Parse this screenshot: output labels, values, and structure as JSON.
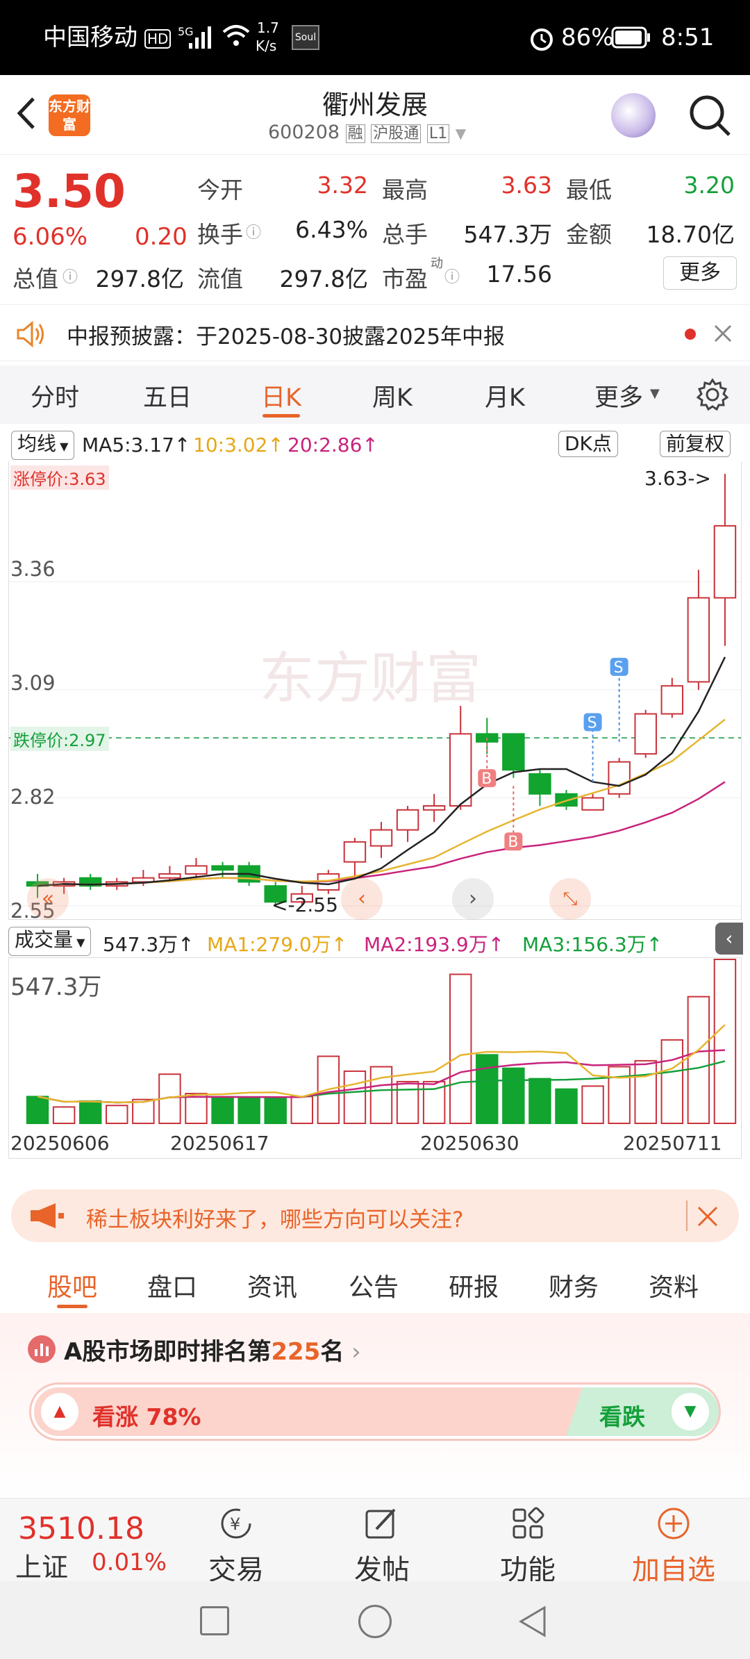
{
  "status": {
    "carrier": "中国移动",
    "hd": "HD",
    "net": "5G",
    "speed_num": "1.7",
    "speed_unit": "K/s",
    "app": "Soul",
    "battery": "86%",
    "time": "8:51"
  },
  "header": {
    "logo": "东方财富",
    "title": "衢州发展",
    "code": "600208",
    "badge1": "融",
    "badge2": "沪股通",
    "badge3": "L1"
  },
  "quote": {
    "price": "3.50",
    "pct": "6.06%",
    "change": "0.20",
    "open_label": "今开",
    "open": "3.32",
    "high_label": "最高",
    "high": "3.63",
    "low_label": "最低",
    "low": "3.20",
    "turnover_label": "换手",
    "turnover": "6.43%",
    "vol_label": "总手",
    "vol": "547.3万",
    "amount_label": "金额",
    "amount": "18.70亿",
    "mcap_label": "总值",
    "mcap": "297.8亿",
    "float_label": "流值",
    "float": "297.8亿",
    "pe_label": "市盈",
    "pe_sup": "动",
    "pe": "17.56",
    "more": "更多"
  },
  "notice": {
    "text": "中报预披露：于2025-08-30披露2025年中报"
  },
  "tabs": [
    "分时",
    "五日",
    "日K",
    "周K",
    "月K",
    "更多"
  ],
  "ma": {
    "selector": "均线",
    "ma5": "MA5:3.17↑",
    "ma10": "10:3.02↑",
    "ma20": "20:2.86↑",
    "dk": "DK点",
    "adjust": "前复权"
  },
  "kline": {
    "limit_up_label": "涨停价:3.63",
    "limit_down_label": "跌停价:2.97",
    "max_marker": "3.63->",
    "min_marker": "<-2.55",
    "watermark": "东方财富",
    "y_ticks": [
      "3.36",
      "3.09",
      "2.82",
      "2.55"
    ]
  },
  "volume": {
    "selector": "成交量",
    "value": "547.3万↑",
    "ma1": "MA1:279.0万↑",
    "ma2": "MA2:193.9万↑",
    "ma3": "MA3:156.3万↑",
    "max_label": "547.3万",
    "dates": [
      "20250606",
      "20250617",
      "20250630",
      "20250711"
    ]
  },
  "banner": {
    "text": "稀土板块利好来了，哪些方向可以关注?"
  },
  "subtabs": [
    "股吧",
    "盘口",
    "资讯",
    "公告",
    "研报",
    "财务",
    "资料"
  ],
  "rank": {
    "prefix": "A股市场即时排名第",
    "num": "225",
    "suffix": "名",
    "up_label": "看涨 78%",
    "down_label": "看跌"
  },
  "bottom": {
    "index_value": "3510.18",
    "index_name": "上证",
    "index_pct": "0.01%",
    "trade": "交易",
    "post": "发帖",
    "func": "功能",
    "add": "加自选"
  },
  "chart_data": {
    "type": "candlestick",
    "y_axis_ticks": [
      3.36,
      3.09,
      2.82,
      2.55
    ],
    "ylim": [
      2.55,
      3.63
    ],
    "limit_up": 3.63,
    "limit_down": 2.97,
    "dates_labeled": [
      "20250606",
      "20250617",
      "20250630",
      "20250711"
    ],
    "candles": [
      {
        "o": 2.61,
        "c": 2.6,
        "h": 2.63,
        "l": 2.57
      },
      {
        "o": 2.6,
        "c": 2.61,
        "h": 2.62,
        "l": 2.58
      },
      {
        "o": 2.62,
        "c": 2.6,
        "h": 2.63,
        "l": 2.59
      },
      {
        "o": 2.6,
        "c": 2.61,
        "h": 2.62,
        "l": 2.59
      },
      {
        "o": 2.61,
        "c": 2.62,
        "h": 2.64,
        "l": 2.6
      },
      {
        "o": 2.62,
        "c": 2.63,
        "h": 2.65,
        "l": 2.61
      },
      {
        "o": 2.63,
        "c": 2.65,
        "h": 2.67,
        "l": 2.62
      },
      {
        "o": 2.65,
        "c": 2.64,
        "h": 2.66,
        "l": 2.62
      },
      {
        "o": 2.65,
        "c": 2.61,
        "h": 2.66,
        "l": 2.6
      },
      {
        "o": 2.6,
        "c": 2.56,
        "h": 2.61,
        "l": 2.55
      },
      {
        "o": 2.56,
        "c": 2.58,
        "h": 2.6,
        "l": 2.55
      },
      {
        "o": 2.59,
        "c": 2.63,
        "h": 2.64,
        "l": 2.58
      },
      {
        "o": 2.66,
        "c": 2.71,
        "h": 2.72,
        "l": 2.62
      },
      {
        "o": 2.7,
        "c": 2.74,
        "h": 2.76,
        "l": 2.67
      },
      {
        "o": 2.74,
        "c": 2.79,
        "h": 2.8,
        "l": 2.71
      },
      {
        "o": 2.79,
        "c": 2.8,
        "h": 2.83,
        "l": 2.76
      },
      {
        "o": 2.8,
        "c": 2.98,
        "h": 3.05,
        "l": 2.79
      },
      {
        "o": 2.98,
        "c": 2.96,
        "h": 3.02,
        "l": 2.93
      },
      {
        "o": 2.98,
        "c": 2.89,
        "h": 2.98,
        "l": 2.87
      },
      {
        "o": 2.88,
        "c": 2.83,
        "h": 2.89,
        "l": 2.8
      },
      {
        "o": 2.83,
        "c": 2.8,
        "h": 2.84,
        "l": 2.79
      },
      {
        "o": 2.79,
        "c": 2.82,
        "h": 2.83,
        "l": 2.79
      },
      {
        "o": 2.83,
        "c": 2.91,
        "h": 2.92,
        "l": 2.82
      },
      {
        "o": 2.93,
        "c": 3.03,
        "h": 3.04,
        "l": 2.92
      },
      {
        "o": 3.03,
        "c": 3.1,
        "h": 3.12,
        "l": 3.02
      },
      {
        "o": 3.11,
        "c": 3.32,
        "h": 3.39,
        "l": 3.09
      },
      {
        "o": 3.32,
        "c": 3.5,
        "h": 3.63,
        "l": 3.2
      }
    ],
    "volumes": [
      180,
      110,
      150,
      120,
      160,
      330,
      200,
      170,
      170,
      170,
      180,
      450,
      350,
      380,
      280,
      280,
      1000,
      460,
      370,
      300,
      230,
      250,
      380,
      420,
      560,
      850,
      1100
    ]
  }
}
